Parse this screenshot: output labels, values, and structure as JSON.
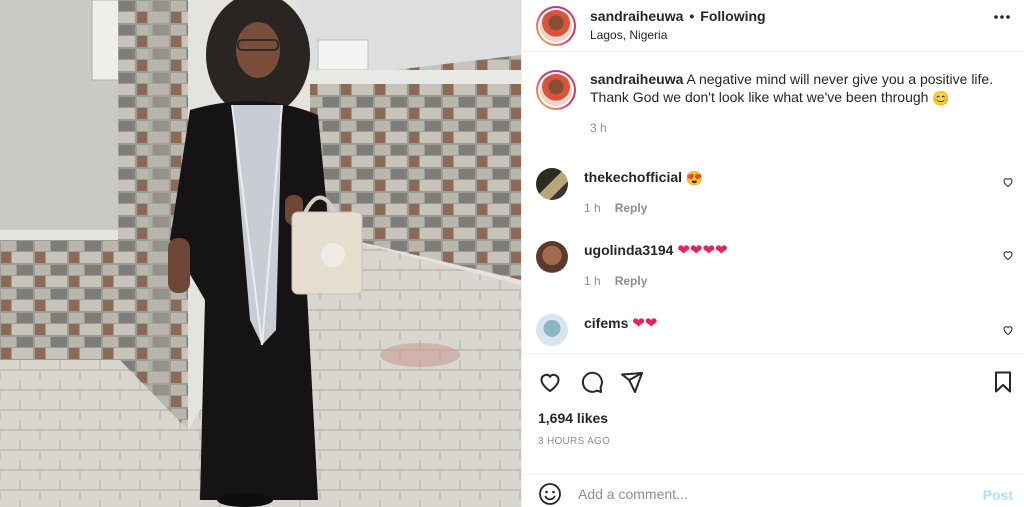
{
  "post": {
    "username": "sandraiheuwa",
    "separator": "•",
    "follow_status": "Following",
    "location": "Lagos, Nigeria",
    "more_icon": "more-horizontal-icon"
  },
  "caption": {
    "username": "sandraiheuwa",
    "text": "A negative mind will never give you a positive life. Thank God we don't look like what we've been through",
    "emoji": "😊",
    "time": "3 h"
  },
  "comments": [
    {
      "username": "thekechofficial",
      "text": "",
      "emoji": "😍",
      "time": "1 h",
      "reply": "Reply"
    },
    {
      "username": "ugolinda3194",
      "text": "",
      "emoji": "❤❤❤❤",
      "time": "1 h",
      "reply": "Reply"
    },
    {
      "username": "cifems",
      "text": "",
      "emoji": "❤❤",
      "time": "",
      "reply": ""
    }
  ],
  "engagement": {
    "likes": "1,694 likes",
    "timestamp": "3 HOURS AGO"
  },
  "composer": {
    "placeholder": "Add a comment...",
    "post_label": "Post"
  },
  "colors": {
    "link_blue_disabled": "#b2dffc",
    "secondary_text": "#8e8e8e",
    "heart_red": "#e0245e"
  }
}
